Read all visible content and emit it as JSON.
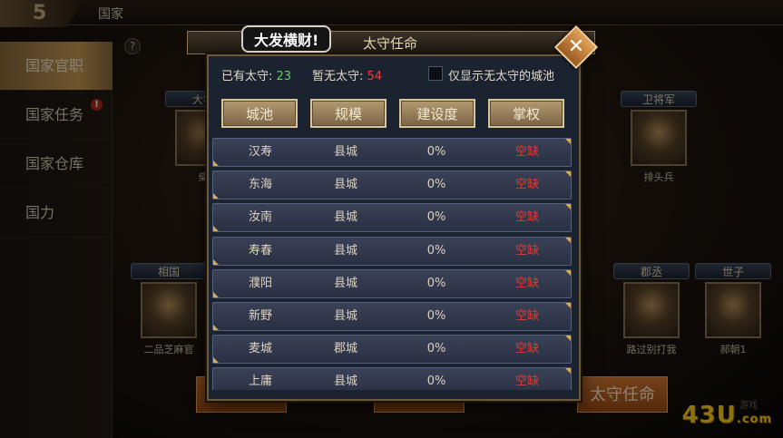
{
  "header": {
    "back_glyph": "5",
    "title": "国家"
  },
  "sidebar": {
    "items": [
      {
        "label": "国家官职",
        "active": true
      },
      {
        "label": "国家任务",
        "active": false
      },
      {
        "label": "国家仓库",
        "active": false,
        "badge": "!"
      },
      {
        "label": "国力",
        "active": false
      }
    ]
  },
  "help": {
    "label": "?"
  },
  "officials": [
    {
      "title": "大将",
      "name": "柴",
      "style": "purple"
    },
    {
      "title": "卫将军",
      "name": "排头兵",
      "style": "purple"
    },
    {
      "title": "相国",
      "name": "二品芝麻官",
      "style": "blue"
    },
    {
      "title": "郡丞",
      "name": "路过别打我",
      "style": "blue"
    },
    {
      "title": "世子",
      "name": "郝朝1",
      "style": "blue"
    }
  ],
  "bottom_action": {
    "label": "太守任命"
  },
  "watermark": {
    "main": "43U",
    "suffix": ".com",
    "sub": "游戏"
  },
  "modal": {
    "title": "太守任命",
    "bubble": "大发横财!",
    "close_label": "✕",
    "stats": {
      "has_label": "已有太守:",
      "has_value": "23",
      "none_label": "暂无太守:",
      "none_value": "54"
    },
    "filter_label": "仅显示无太守的城池",
    "filter_checked": false,
    "sort_buttons": [
      "城池",
      "规模",
      "建设度",
      "掌权"
    ],
    "rows": [
      {
        "city": "汉寿",
        "scale": "县城",
        "build": "0%",
        "ruler": "空缺"
      },
      {
        "city": "东海",
        "scale": "县城",
        "build": "0%",
        "ruler": "空缺"
      },
      {
        "city": "汝南",
        "scale": "县城",
        "build": "0%",
        "ruler": "空缺"
      },
      {
        "city": "寿春",
        "scale": "县城",
        "build": "0%",
        "ruler": "空缺"
      },
      {
        "city": "濮阳",
        "scale": "县城",
        "build": "0%",
        "ruler": "空缺"
      },
      {
        "city": "新野",
        "scale": "县城",
        "build": "0%",
        "ruler": "空缺"
      },
      {
        "city": "麦城",
        "scale": "郡城",
        "build": "0%",
        "ruler": "空缺"
      },
      {
        "city": "上庸",
        "scale": "县城",
        "build": "0%",
        "ruler": "空缺"
      }
    ]
  }
}
